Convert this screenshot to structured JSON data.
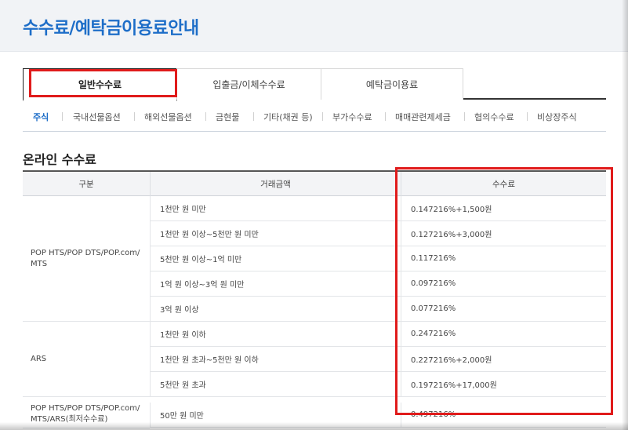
{
  "page": {
    "title": "수수료/예탁금이용료안내"
  },
  "tabs": [
    {
      "label": "일반수수료",
      "active": true
    },
    {
      "label": "입출금/이체수수료",
      "active": false
    },
    {
      "label": "예탁금이용료",
      "active": false
    }
  ],
  "subtabs": [
    {
      "label": "주식",
      "active": true
    },
    {
      "label": "국내선물옵션"
    },
    {
      "label": "해외선물옵션"
    },
    {
      "label": "금현물"
    },
    {
      "label": "기타(채권 등)"
    },
    {
      "label": "부가수수료"
    },
    {
      "label": "매매관련제세금"
    },
    {
      "label": "협의수수료"
    },
    {
      "label": "비상장주식"
    }
  ],
  "section": {
    "title": "온라인 수수료"
  },
  "table": {
    "headers": [
      "구분",
      "거래금액",
      "수수료"
    ],
    "groups": [
      {
        "label": "POP HTS/POP DTS/POP.com/ MTS",
        "rows": [
          {
            "amount": "1천만 원 미만",
            "fee": "0.147216%+1,500원"
          },
          {
            "amount": "1천만 원 이상~5천만 원 미만",
            "fee": "0.127216%+3,000원"
          },
          {
            "amount": "5천만 원 이상~1억 미만",
            "fee": "0.117216%"
          },
          {
            "amount": "1억 원 이상~3억 원 미만",
            "fee": "0.097216%"
          },
          {
            "amount": "3억 원 이상",
            "fee": "0.077216%"
          }
        ]
      },
      {
        "label": "ARS",
        "rows": [
          {
            "amount": "1천만 원 이하",
            "fee": "0.247216%"
          },
          {
            "amount": "1천만 원 초과~5천만 원 이하",
            "fee": "0.227216%+2,000원"
          },
          {
            "amount": "5천만 원 초과",
            "fee": "0.197216%+17,000원"
          }
        ]
      },
      {
        "label": "POP HTS/POP DTS/POP.com/ MTS/ARS(최저수수료)",
        "rows": [
          {
            "amount": "50만 원 미만",
            "fee": "0.497216%"
          }
        ]
      }
    ]
  },
  "colors": {
    "accent": "#1e6ec8",
    "highlight": "#e01b1b"
  }
}
